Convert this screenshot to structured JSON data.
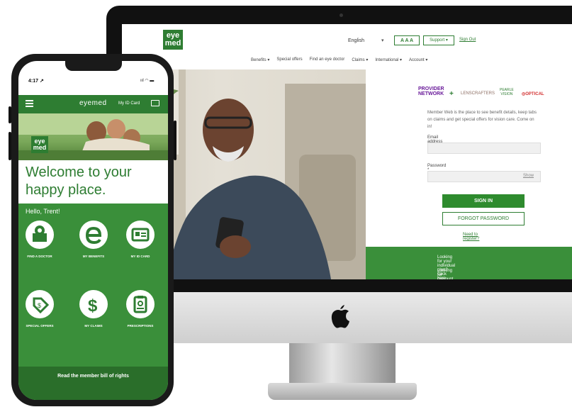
{
  "desktop": {
    "logo_text": "eye\nmed",
    "language": "English",
    "language_caret": "▾",
    "text_size": "A A A",
    "support": "Support ▾",
    "sign_out": "Sign Out",
    "nav": [
      "Benefits ▾",
      "Special offers",
      "Find an eye doctor",
      "Claims ▾",
      "International ▾",
      "Account ▾"
    ],
    "partners": {
      "network": "PROVIDER\nNETWORK",
      "plus": "+",
      "lenscrafters": "LENSCRAFTERS",
      "pearle": "PEARLE\nVISION",
      "optical": "◎OPTICAL"
    },
    "intro": "Member Web is the place to see benefit details, keep tabs on claims and get special offers for vision care. Come on in!",
    "email_label": "Email address *",
    "password_label": "Password *",
    "show": "Show",
    "sign_in": "SIGN IN",
    "forgot_password": "FORGOT PASSWORD",
    "need_register": "Need to register?",
    "individual_link": "Looking for your individual plan? Click here",
    "discount_link": "Looking for discount plans? Find them now"
  },
  "phone": {
    "time": "4:17 ↗",
    "status_icons": "ııl ◠ ▬",
    "brand": "eyemed",
    "id_card_label": "My ID Card",
    "hero_logo": "eye\nmed",
    "welcome_line1": "Welcome to your",
    "welcome_line2": "happy place.",
    "hello": "Hello, Trent!",
    "tiles": [
      {
        "label": "FIND A DOCTOR",
        "icon": "map-pin-icon"
      },
      {
        "label": "MY BENEFITS",
        "icon": "eyemed-e-icon"
      },
      {
        "label": "MY ID CARD",
        "icon": "id-card-icon"
      },
      {
        "label": "SPECIAL OFFERS",
        "icon": "price-tag-icon"
      },
      {
        "label": "MY CLAIMS",
        "icon": "dollar-icon"
      },
      {
        "label": "PRESCRIPTIONS",
        "icon": "clipboard-icon"
      }
    ],
    "bill_of_rights": "Read the member bill of rights"
  },
  "colors": {
    "brand_green": "#2e7d32",
    "panel_green": "#3a8f3a"
  }
}
